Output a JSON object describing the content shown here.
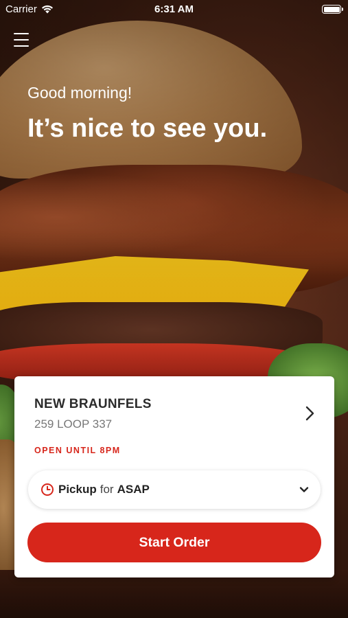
{
  "status_bar": {
    "carrier": "Carrier",
    "time": "6:31 AM"
  },
  "menu": {
    "icon": "hamburger-menu-icon"
  },
  "hero": {
    "greeting": "Good morning!",
    "headline": "It’s nice to see you."
  },
  "location": {
    "name": "NEW BRAUNFELS",
    "address": "259 LOOP 337",
    "hours": "OPEN UNTIL 8PM"
  },
  "order_options": {
    "mode": "Pickup",
    "connector": "for",
    "when": "ASAP"
  },
  "actions": {
    "start_order": "Start Order"
  },
  "colors": {
    "accent": "#d7261b",
    "card_bg": "#ffffff",
    "title_text": "#2b2b2b"
  }
}
